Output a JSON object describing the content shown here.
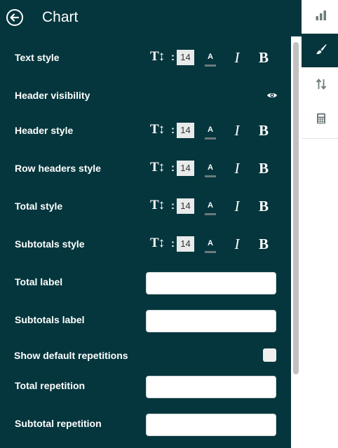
{
  "header": {
    "title": "Chart"
  },
  "font_size_value": "14",
  "style_rows": [
    {
      "label": "Text style"
    },
    {
      "label": "Header style"
    },
    {
      "label": "Row headers style"
    },
    {
      "label": "Total style"
    },
    {
      "label": "Subtotals style"
    }
  ],
  "icons": {
    "text_size": "T↕",
    "colon": ":",
    "color": "A",
    "italic": "I",
    "bold": "B"
  },
  "header_visibility": {
    "label": "Header visibility",
    "icon": "eye-icon"
  },
  "total_label": {
    "label": "Total label",
    "value": ""
  },
  "subtotals_label": {
    "label": "Subtotals label",
    "value": ""
  },
  "show_default_repetitions": {
    "label": "Show default repetitions",
    "checked": false
  },
  "total_repetition": {
    "label": "Total repetition",
    "value": ""
  },
  "subtotal_repetition": {
    "label": "Subtotal repetition",
    "value": ""
  },
  "sidebar": {
    "tabs": [
      {
        "name": "bar-chart-icon",
        "active": false
      },
      {
        "name": "paint-brush-icon",
        "active": true
      },
      {
        "name": "sort-arrows-icon",
        "active": false
      },
      {
        "name": "calculator-icon",
        "active": false
      }
    ]
  },
  "colors": {
    "panel_bg": "#05363d",
    "input_bg": "#ffffff",
    "size_box_bg": "#e9eaea",
    "scrollbar_thumb": "#c1c1c1",
    "sidebar_icon": "#6f7b7d"
  }
}
